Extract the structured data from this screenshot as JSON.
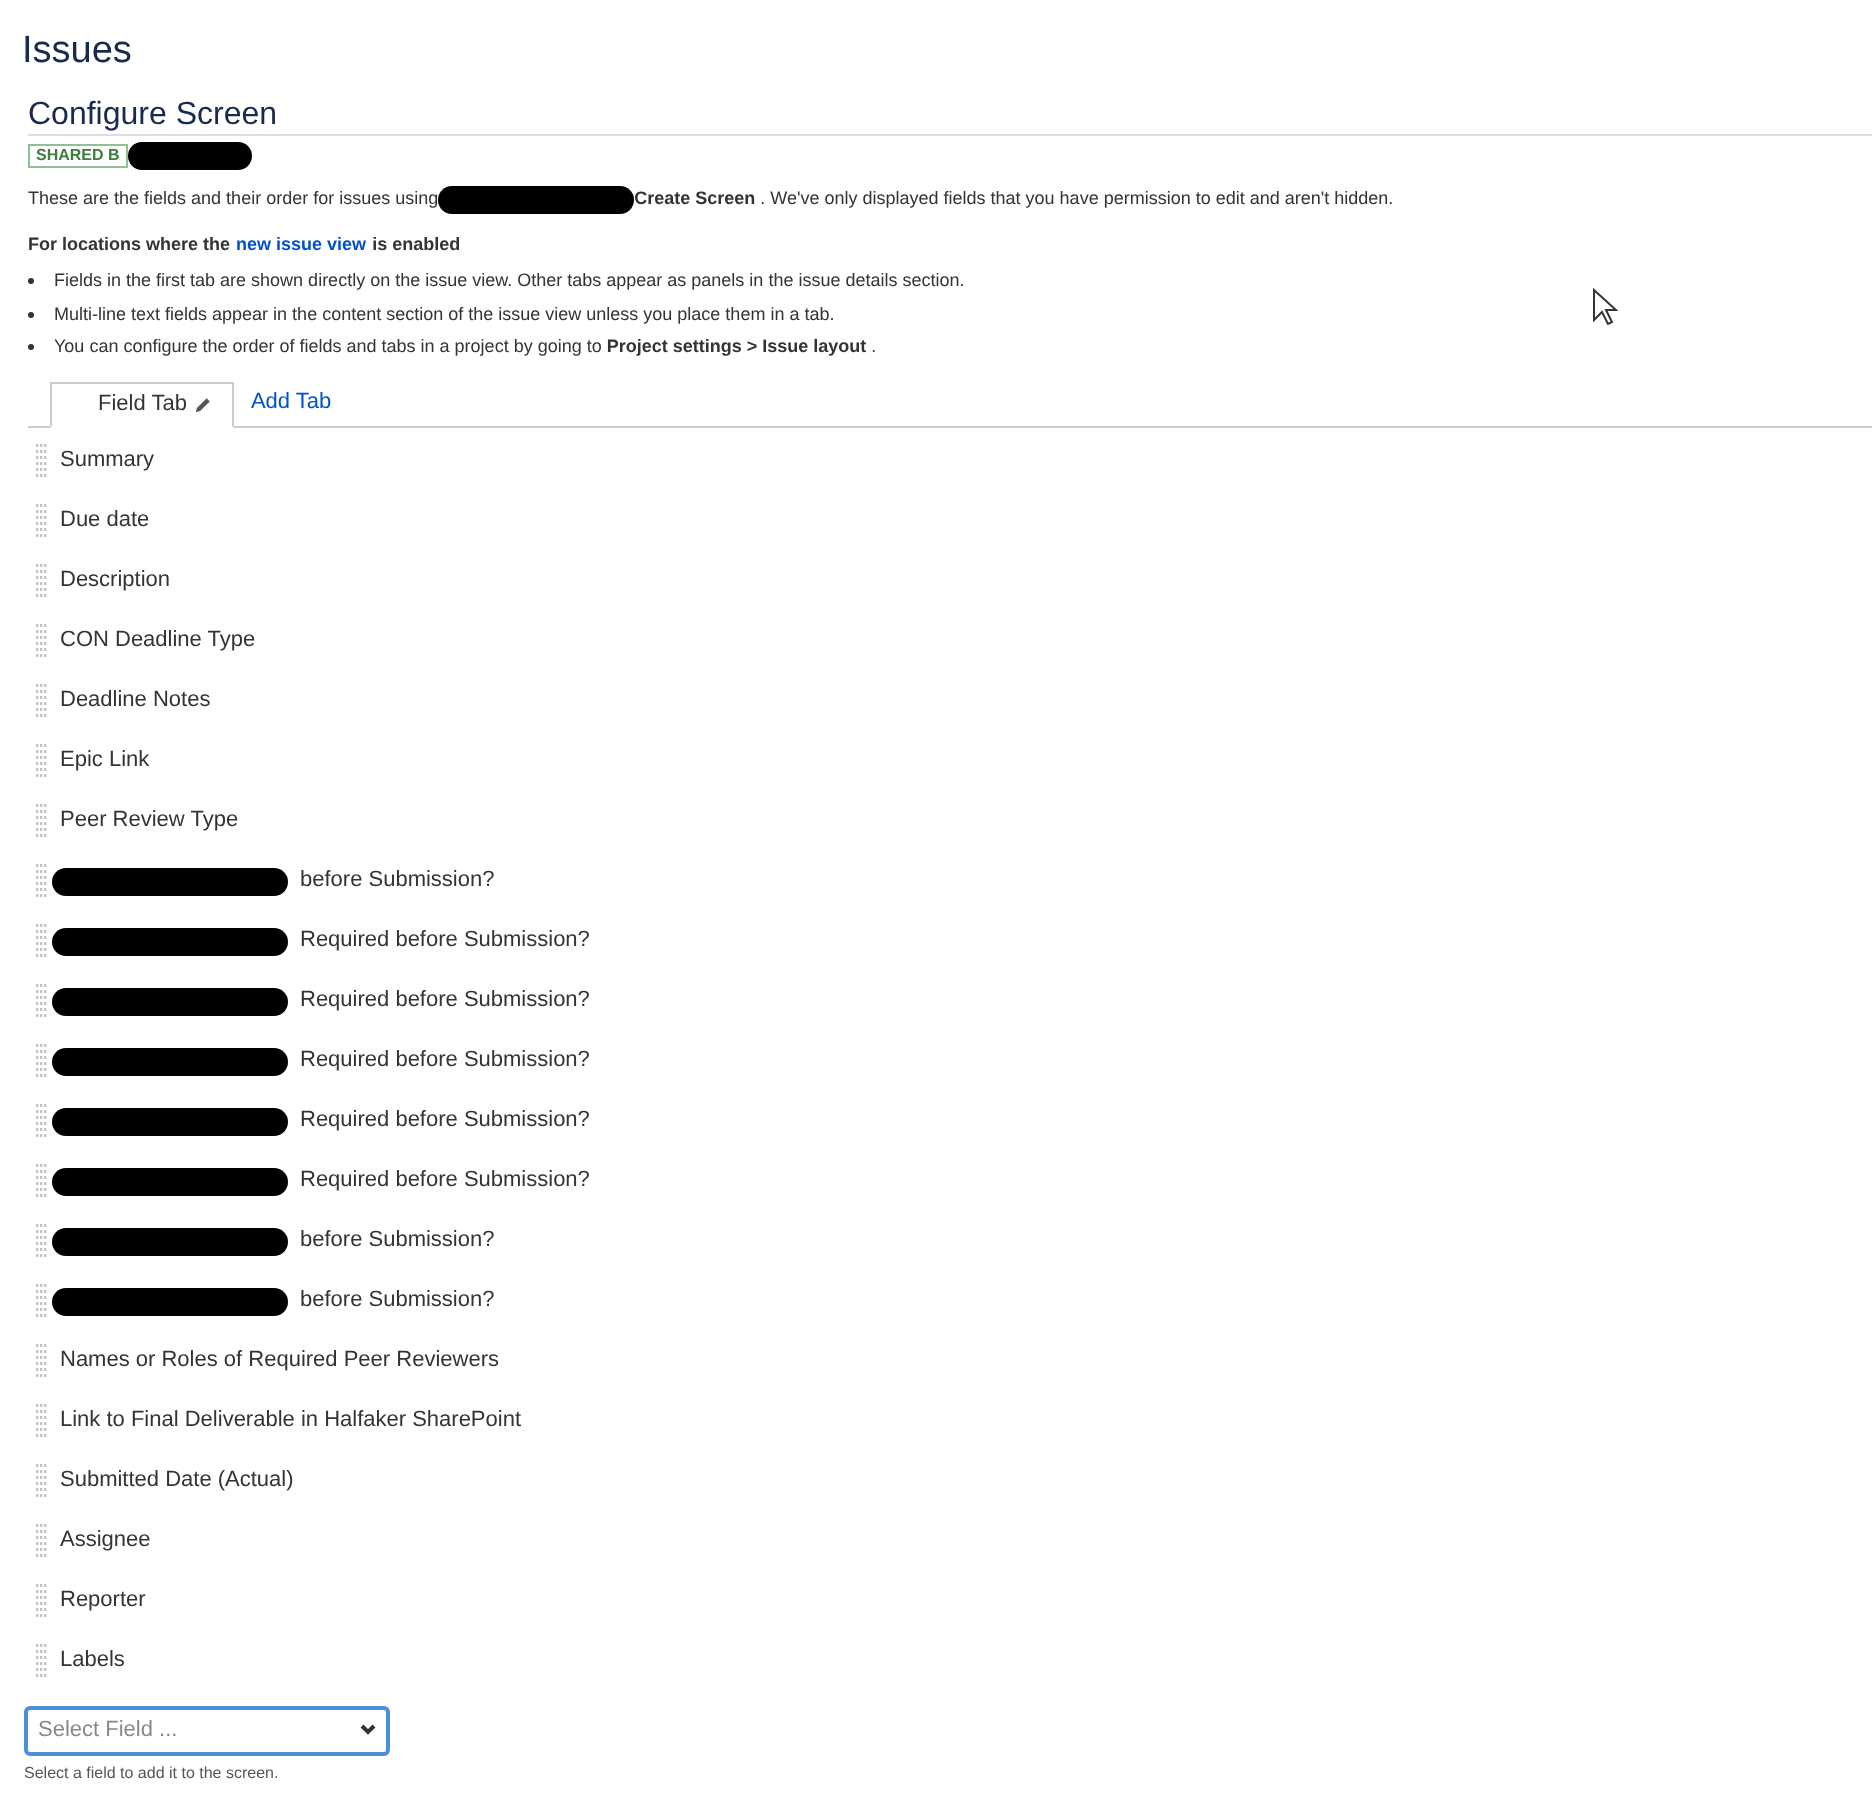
{
  "page_title": "Issues",
  "screen": {
    "title": "Configure Screen",
    "badge": "SHARED B",
    "badge_redacted": true
  },
  "intro": {
    "before": "These are the fields and their order for issues using",
    "redacted": true,
    "after": "**Create Screen** . We've only displayed fields that you have permission to edit and aren't hidden."
  },
  "notice": {
    "before": "For locations where the",
    "link": "new issue view",
    "after": "is enabled"
  },
  "bullets": [
    "Fields in the first tab are shown directly on the issue view. Other tabs appear as panels in the issue details section.",
    "Multi-line text fields appear in the content section of the issue view unless you place them in a tab.",
    "You can configure the order of fields and tabs in a project by going to **Project settings > Issue layout** ."
  ],
  "tabs": [
    {
      "label": "Field Tab",
      "selected": true
    },
    {
      "label": "Add Tab",
      "selected": false
    }
  ],
  "fields": [
    {
      "kind": "plain",
      "label": "Summary"
    },
    {
      "kind": "plain",
      "label": "Due date"
    },
    {
      "kind": "plain",
      "label": "Description"
    },
    {
      "kind": "plain",
      "label": "CON Deadline Type"
    },
    {
      "kind": "plain",
      "label": "Deadline Notes"
    },
    {
      "kind": "plain",
      "label": "Epic Link"
    },
    {
      "kind": "plain",
      "label": "Peer Review Type"
    },
    {
      "kind": "redacted",
      "label": "before Submission?"
    },
    {
      "kind": "redacted",
      "label": "Required before Submission?"
    },
    {
      "kind": "redacted",
      "label": "Required before Submission?"
    },
    {
      "kind": "redacted",
      "label": "Required before Submission?"
    },
    {
      "kind": "redacted",
      "label": "Required before Submission?"
    },
    {
      "kind": "redacted",
      "label": "Required before Submission?"
    },
    {
      "kind": "redacted",
      "label": "before Submission?"
    },
    {
      "kind": "redacted",
      "label": "before Submission?"
    },
    {
      "kind": "plain",
      "label": "Names or Roles of Required Peer Reviewers"
    },
    {
      "kind": "plain",
      "label": "Link to Final Deliverable in Halfaker SharePoint"
    },
    {
      "kind": "plain",
      "label": "Submitted Date (Actual)"
    },
    {
      "kind": "plain",
      "label": "Assignee"
    },
    {
      "kind": "plain",
      "label": "Reporter"
    },
    {
      "kind": "plain",
      "label": "Labels"
    }
  ],
  "select": {
    "placeholder": "Select Field ...",
    "help": "Select a field to add it to the screen."
  }
}
